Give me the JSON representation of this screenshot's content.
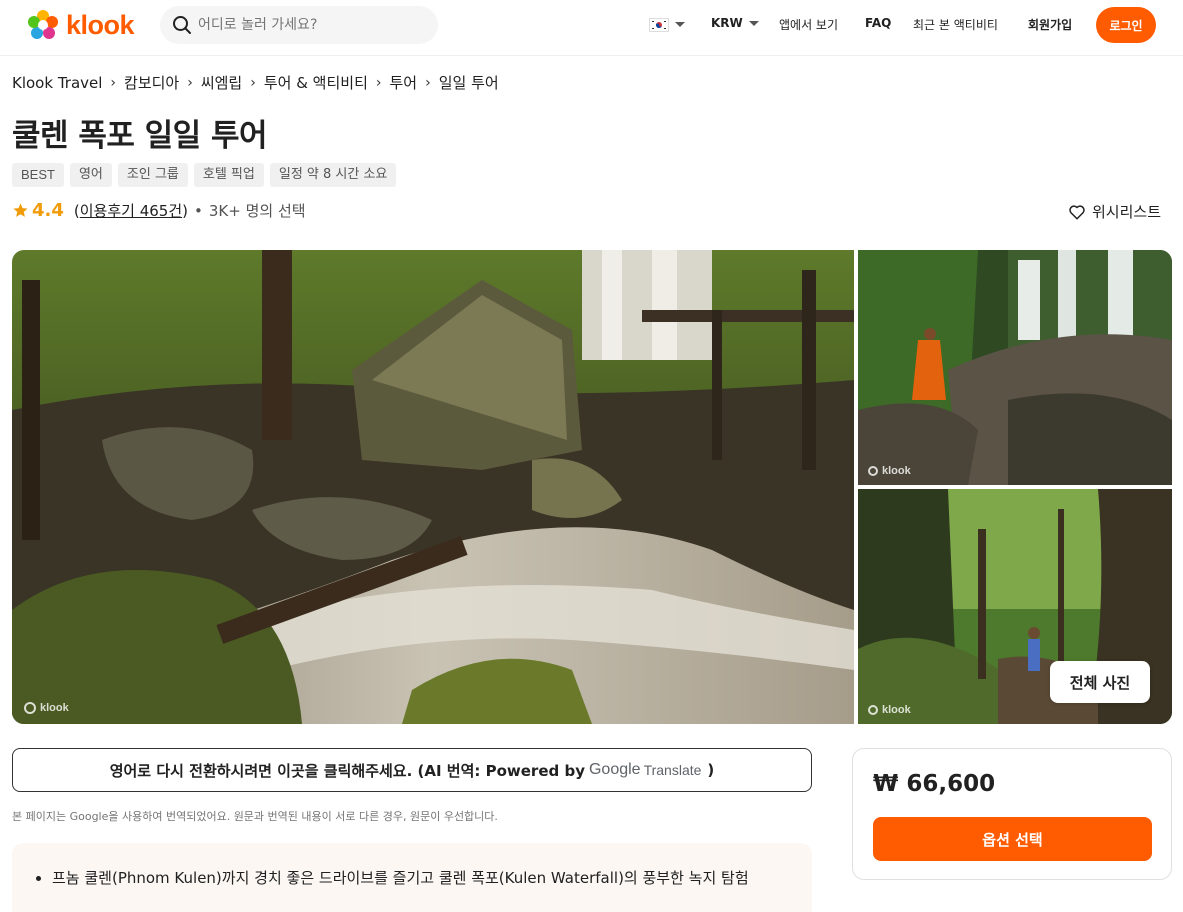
{
  "colors": {
    "brand": "#ff5b00",
    "rating": "#f09b0a"
  },
  "header": {
    "logo_text": "klook",
    "search_placeholder": "어디로 놀러 가세요?",
    "currency": "KRW",
    "app_label": "앱에서 보기",
    "faq_label": "FAQ",
    "recent_label": "최근 본 액티비티",
    "signup_label": "회원가입",
    "login_label": "로그인"
  },
  "breadcrumb": [
    "Klook Travel",
    "캄보디아",
    "씨엠립",
    "투어 & 액티비티",
    "투어",
    "일일 투어"
  ],
  "title": "쿨렌 폭포 일일 투어",
  "tags": [
    "BEST",
    "영어",
    "조인 그룹",
    "호텔 픽업",
    "일정 약 8 시간  소요"
  ],
  "rating": {
    "score": "4.4",
    "open_paren": "(",
    "reviews": "이용후기 465건",
    "close_paren": ")",
    "dot": "•",
    "booked": "3K+ 명의 선택"
  },
  "wishlist_label": "위시리스트",
  "gallery": {
    "watermark": "klook",
    "all_photos_label": "전체 사진"
  },
  "translate": {
    "main_text": "영어로 다시 전환하시려면 이곳을 클릭해주세요. (AI 번역: Powered by",
    "google": "Google",
    "translate_word": "Translate",
    "close_paren": ")",
    "note": "본 페이지는 Google을 사용하여 번역되었어요. 원문과 번역된 내용이 서로 다른 경우, 원문이 우선합니다."
  },
  "highlights": [
    "프놈 쿨렌(Phnom Kulen)까지 경치 좋은 드라이브를 즐기고 쿨렌 폭포(Kulen Waterfall)의 풍부한 녹지 탐험"
  ],
  "booking": {
    "price": "₩ 66,600",
    "option_label": "옵션 선택"
  }
}
